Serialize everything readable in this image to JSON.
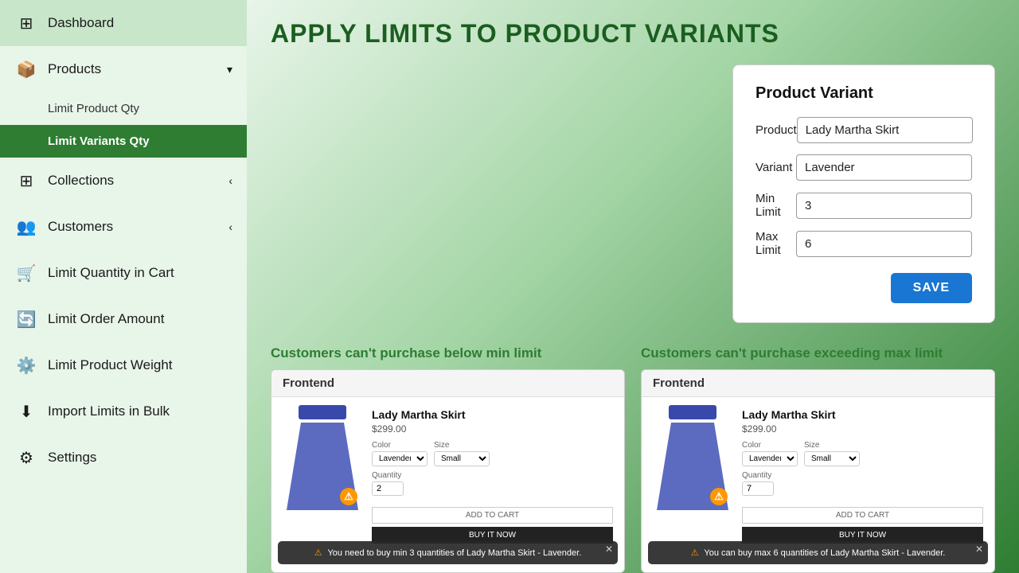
{
  "sidebar": {
    "dashboard_label": "Dashboard",
    "products_label": "Products",
    "limit_product_qty_label": "Limit Product Qty",
    "limit_variants_qty_label": "Limit Variants Qty",
    "collections_label": "Collections",
    "customers_label": "Customers",
    "limit_quantity_cart_label": "Limit Quantity in Cart",
    "limit_order_amount_label": "Limit Order Amount",
    "limit_product_weight_label": "Limit Product Weight",
    "import_limits_label": "Import Limits in Bulk",
    "settings_label": "Settings"
  },
  "main": {
    "page_title": "APPLY LIMITS TO PRODUCT VARIANTS",
    "variant_card": {
      "heading": "Product Variant",
      "product_label": "Product",
      "product_value": "Lady Martha Skirt",
      "variant_label": "Variant",
      "variant_value": "Lavender",
      "min_limit_label": "Min Limit",
      "min_limit_value": "3",
      "max_limit_label": "Max Limit",
      "max_limit_value": "6",
      "save_label": "SAVE"
    },
    "demo_min": {
      "label": "Customers can't purchase below min limit",
      "frontend_label": "Frontend",
      "prod_name": "Lady Martha Skirt",
      "price": "$299.00",
      "color_label": "Color",
      "color_value": "Lavender",
      "size_label": "Size",
      "size_value": "Small",
      "qty_label": "Quantity",
      "qty_value": "2",
      "add_to_cart": "ADD TO CART",
      "buy_now": "BUY IT NOW",
      "tooltip": "You need to buy min 3 quantities of Lady Martha Skirt - Lavender."
    },
    "demo_max": {
      "label": "Customers can't purchase exceeding max limit",
      "frontend_label": "Frontend",
      "prod_name": "Lady Martha Skirt",
      "price": "$299.00",
      "color_label": "Color",
      "color_value": "Lavender",
      "size_label": "Size",
      "size_value": "Small",
      "qty_label": "Quantity",
      "qty_value": "7",
      "add_to_cart": "ADD TO CART",
      "buy_now": "BUY IT NOW",
      "tooltip": "You can buy max 6 quantities of Lady Martha Skirt - Lavender."
    }
  }
}
